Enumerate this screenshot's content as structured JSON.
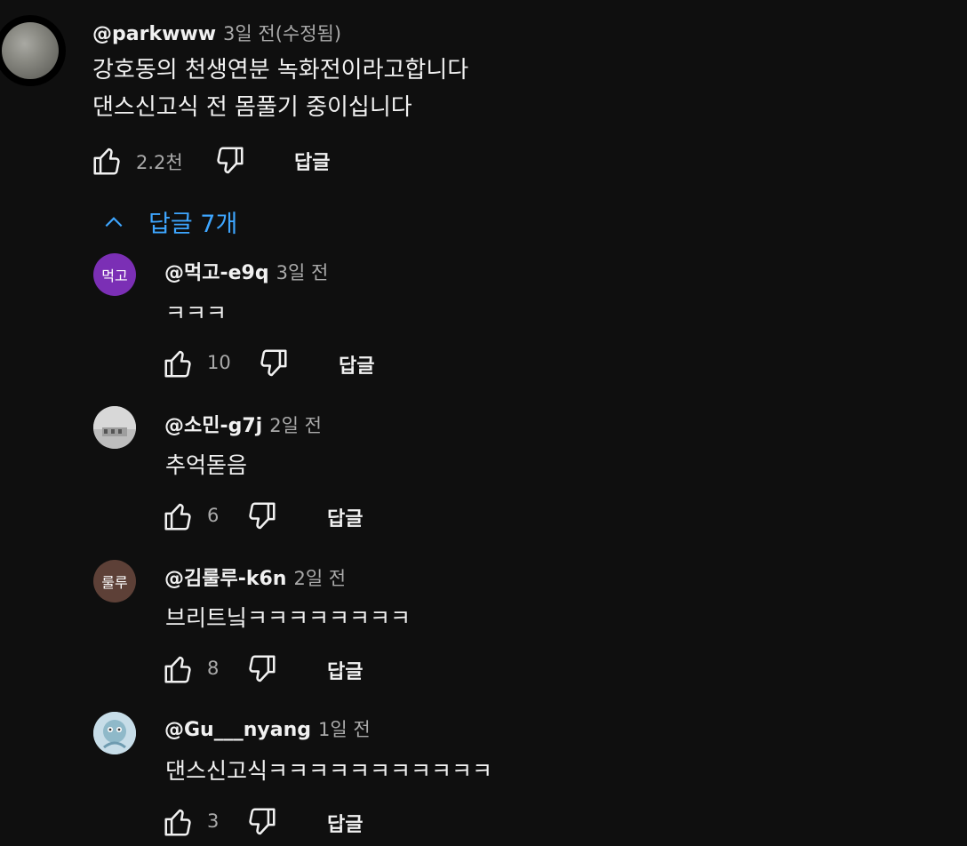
{
  "top_comment": {
    "author": "@parkwww",
    "time": "3일 전(수정됨)",
    "lines": [
      "강호동의 천생연분 녹화전이라고합니다",
      "댄스신고식 전 몸풀기 중이십니다"
    ],
    "likes": "2.2천",
    "reply_label": "답글",
    "avatar_icon": "moon-avatar"
  },
  "replies_toggle": {
    "label": "답글 7개",
    "icon": "chevron-up-icon",
    "color": "#3ea6ff"
  },
  "replies": [
    {
      "author": "@먹고-e9q",
      "time": "3일 전",
      "text": "ㅋㅋㅋ",
      "likes": "10",
      "reply_label": "답글",
      "avatar_text": "먹고",
      "avatar_color": "#7b2fb5"
    },
    {
      "author": "@소민-g7j",
      "time": "2일 전",
      "text": "추억돋음",
      "likes": "6",
      "reply_label": "답글",
      "avatar_icon": "building-photo-avatar",
      "avatar_color": "#cfcfcf"
    },
    {
      "author": "@김룰루-k6n",
      "time": "2일 전",
      "text": "브리트닠ㅋㅋㅋㅋㅋㅋㅋㅋ",
      "likes": "8",
      "reply_label": "답글",
      "avatar_text": "룰루",
      "avatar_color": "#5d4037"
    },
    {
      "author": "@Gu___nyang",
      "time": "1일 전",
      "text": "댄스신고식ㅋㅋㅋㅋㅋㅋㅋㅋㅋㅋㅋ",
      "likes": "3",
      "reply_label": "답글",
      "avatar_icon": "cartoon-avatar",
      "avatar_color": "#b9d3e0"
    }
  ]
}
